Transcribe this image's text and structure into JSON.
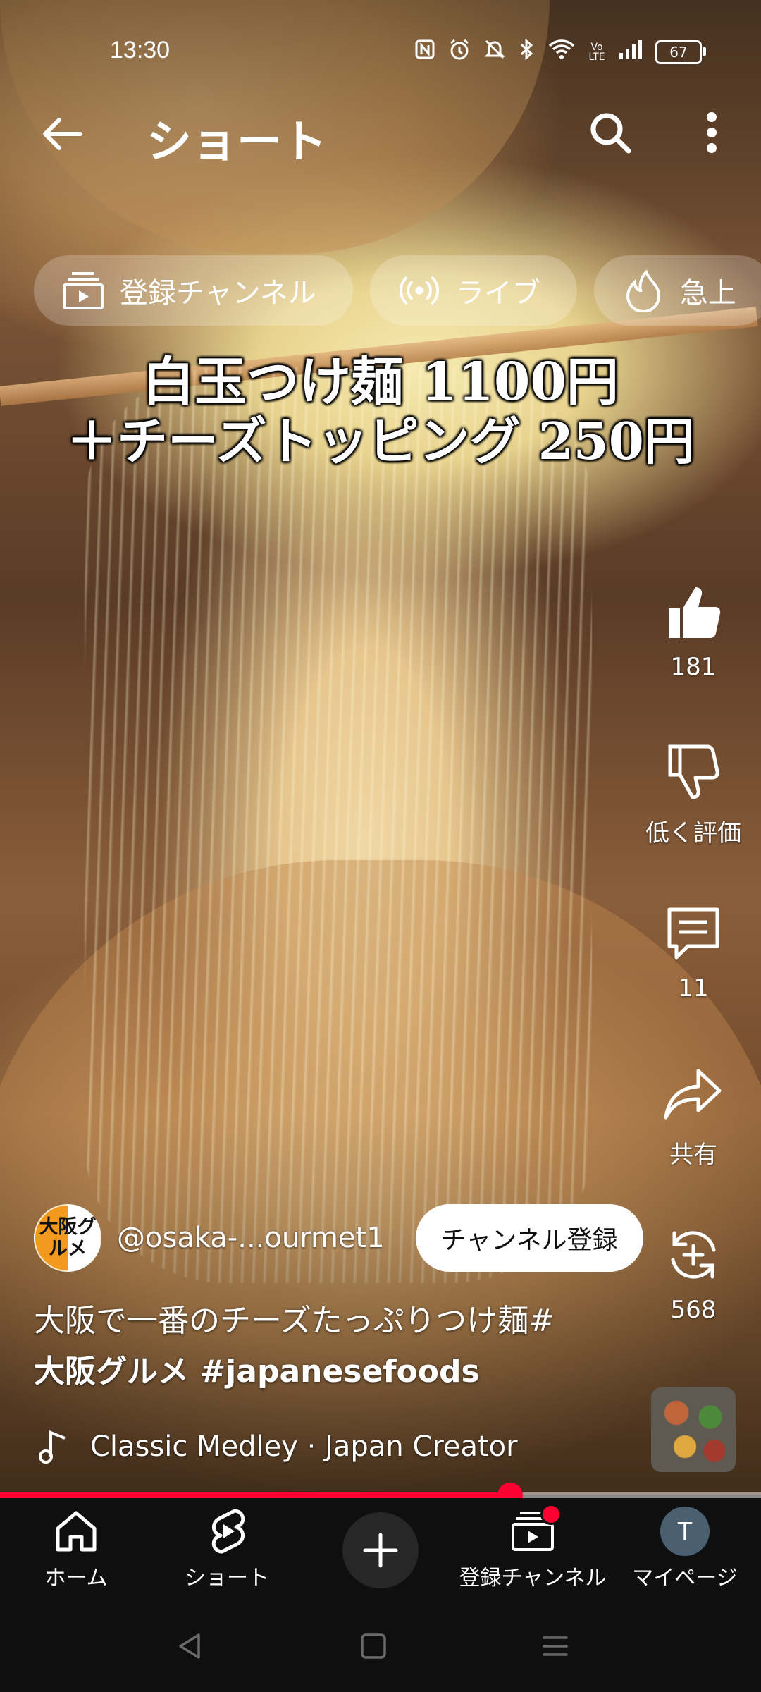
{
  "status_bar": {
    "time": "13:30",
    "battery": "67",
    "icons": [
      "nfc-icon",
      "alarm-icon",
      "mute-icon",
      "bluetooth-icon",
      "wifi-icon",
      "volte-icon",
      "signal-icon",
      "battery-icon"
    ],
    "volte_label": "Vo LTE"
  },
  "header": {
    "title": "ショート",
    "back_icon": "back-arrow-icon",
    "search_icon": "search-icon",
    "more_icon": "more-vert-icon"
  },
  "chips": [
    {
      "label": "登録チャンネル",
      "icon": "subscriptions-icon"
    },
    {
      "label": "ライブ",
      "icon": "live-icon"
    },
    {
      "label": "急上",
      "icon": "trending-icon"
    }
  ],
  "video": {
    "caption_line1": "白玉つけ麺 1100円",
    "caption_line2": "＋チーズトッピング 250円"
  },
  "actions": {
    "like_count": "181",
    "dislike_label": "低く評価",
    "comment_count": "11",
    "share_label": "共有",
    "remix_count": "568"
  },
  "channel": {
    "avatar_text": "大阪グルメ",
    "handle": "@osaka-...ourmet1",
    "subscribe_label": "チャンネル登録"
  },
  "description": {
    "line1": "大阪で一番のチーズたっぷりつけ麺#",
    "line2": "大阪グルメ #japanesefoods"
  },
  "music": {
    "text": "Classic Medley · Japan Creator"
  },
  "progress": {
    "fraction": 0.67
  },
  "bottom_nav": [
    {
      "label": "ホーム",
      "icon": "home-icon"
    },
    {
      "label": "ショート",
      "icon": "shorts-icon"
    },
    {
      "label": "",
      "icon": "plus-icon"
    },
    {
      "label": "登録チャンネル",
      "icon": "subscriptions-icon"
    },
    {
      "label": "マイページ",
      "icon": "avatar"
    }
  ],
  "me_avatar_letter": "T",
  "colors": {
    "accent": "#ff0033",
    "nav_bg": "#0f0f0f"
  }
}
